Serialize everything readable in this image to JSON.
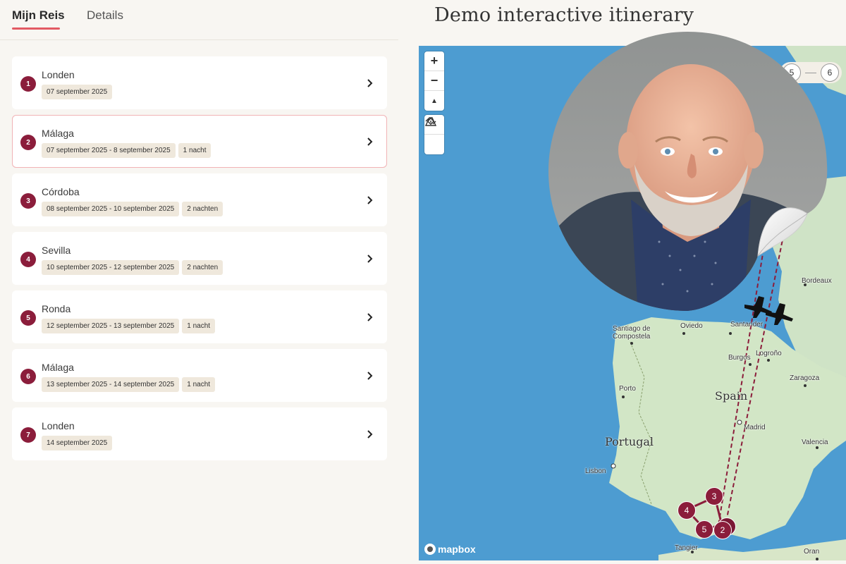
{
  "tabs": [
    {
      "label": "Mijn Reis",
      "active": true
    },
    {
      "label": "Details",
      "active": false
    }
  ],
  "title": "Demo interactive itinerary",
  "stops": [
    {
      "num": "1",
      "city": "Londen",
      "dates": "07 september 2025",
      "nights": ""
    },
    {
      "num": "2",
      "city": "Málaga",
      "dates": "07 september 2025 - 8 september 2025",
      "nights": "1 nacht",
      "selected": true
    },
    {
      "num": "3",
      "city": "Córdoba",
      "dates": "08 september 2025 - 10 september 2025",
      "nights": "2 nachten"
    },
    {
      "num": "4",
      "city": "Sevilla",
      "dates": "10 september 2025 - 12 september 2025",
      "nights": "2 nachten"
    },
    {
      "num": "5",
      "city": "Ronda",
      "dates": "12 september 2025 - 13 september 2025",
      "nights": "1 nacht"
    },
    {
      "num": "6",
      "city": "Málaga",
      "dates": "13 september 2025 - 14 september 2025",
      "nights": "1 nacht"
    },
    {
      "num": "7",
      "city": "Londen",
      "dates": "14 september 2025",
      "nights": ""
    }
  ],
  "map": {
    "zoom_in": "+",
    "zoom_out": "−",
    "compass": "▲",
    "attribution": "mapbox",
    "pager": [
      "5",
      "6"
    ],
    "labels": {
      "bordeaux": "Bordeaux",
      "santiago": "Santiago de\nCompostela",
      "oviedo": "Oviedo",
      "santander": "Santander",
      "logrono": "Logroño",
      "burgos": "Burgos",
      "zaragoza": "Zaragoza",
      "porto": "Porto",
      "madrid": "Madrid",
      "valencia": "Valencia",
      "lisbon": "Lisbon",
      "tangier": "Tangier",
      "oran": "Oran"
    },
    "countries": {
      "spain": "Spain",
      "portugal": "Portugal"
    },
    "markers": {
      "m3": "3",
      "m4": "4",
      "m5": "5",
      "m2": "2"
    }
  },
  "colors": {
    "accent": "#8b1d3b",
    "tab_underline": "#e25a63",
    "sea": "#4d9cd1",
    "land": "#cfe3c6"
  }
}
